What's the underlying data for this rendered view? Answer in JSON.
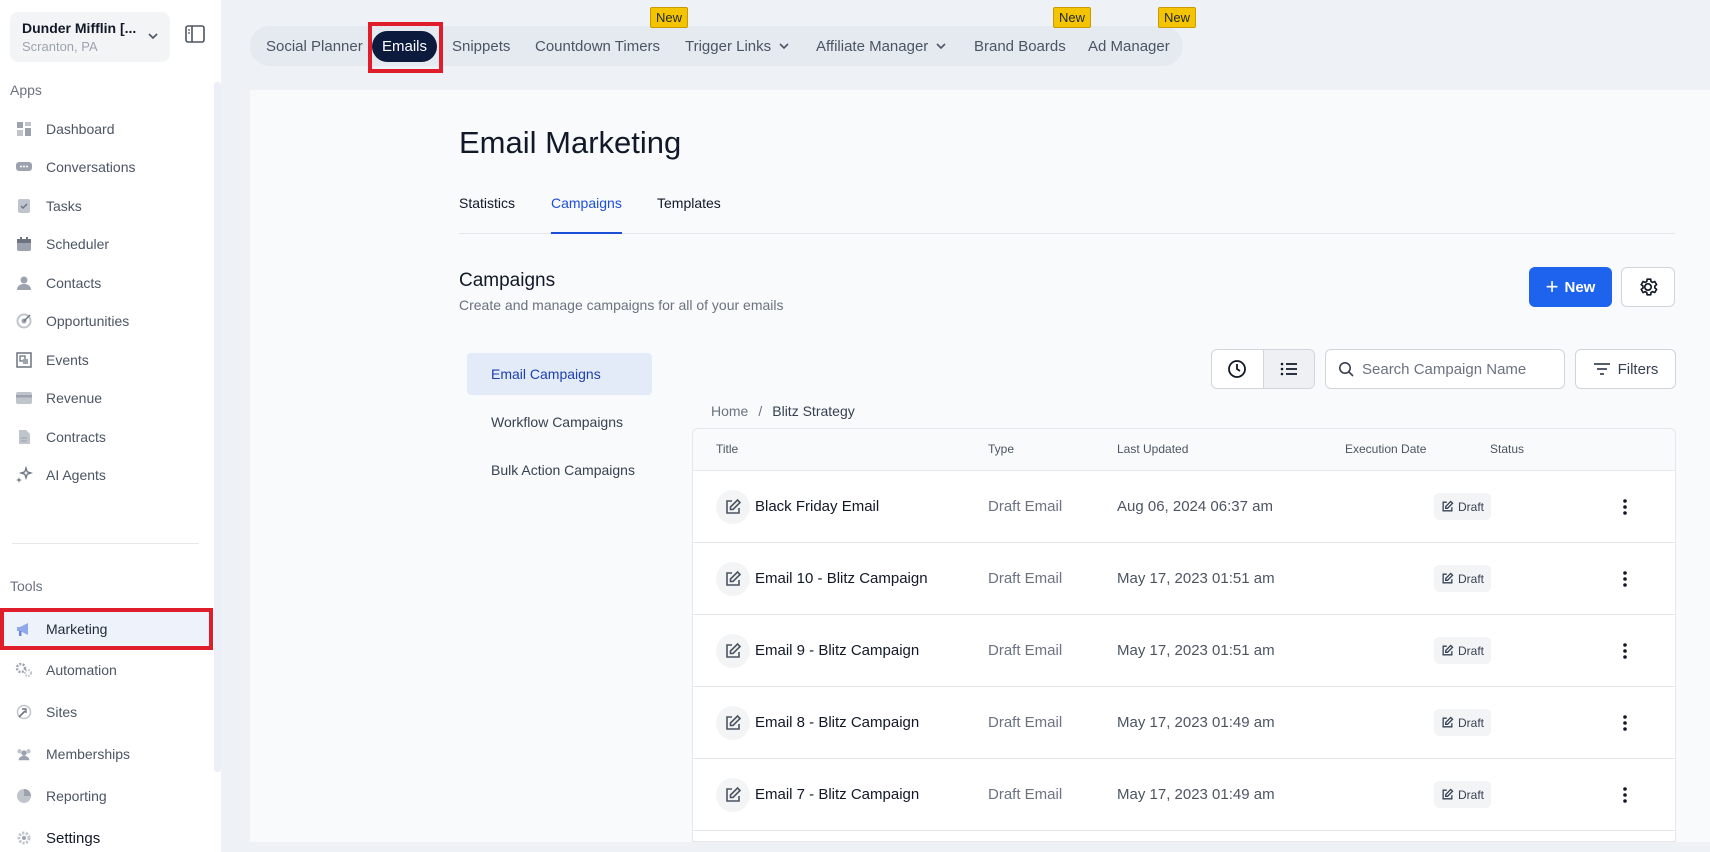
{
  "location": {
    "name": "Dunder Mifflin [...",
    "sub": "Scranton, PA"
  },
  "sidebar": {
    "apps_label": "Apps",
    "tools_label": "Tools",
    "apps": [
      {
        "label": "Dashboard",
        "icon": "dashboard-icon"
      },
      {
        "label": "Conversations",
        "icon": "chat-icon"
      },
      {
        "label": "Tasks",
        "icon": "tasks-icon"
      },
      {
        "label": "Scheduler",
        "icon": "calendar-icon"
      },
      {
        "label": "Contacts",
        "icon": "person-icon"
      },
      {
        "label": "Opportunities",
        "icon": "target-icon"
      },
      {
        "label": "Events",
        "icon": "events-icon"
      },
      {
        "label": "Revenue",
        "icon": "card-icon"
      },
      {
        "label": "Contracts",
        "icon": "document-icon"
      },
      {
        "label": "AI Agents",
        "icon": "sparkle-icon"
      }
    ],
    "tools": [
      {
        "label": "Marketing",
        "icon": "megaphone-icon"
      },
      {
        "label": "Automation",
        "icon": "gears-icon"
      },
      {
        "label": "Sites",
        "icon": "sites-icon"
      },
      {
        "label": "Memberships",
        "icon": "group-icon"
      },
      {
        "label": "Reporting",
        "icon": "pie-icon"
      },
      {
        "label": "Settings",
        "icon": "gear-icon"
      }
    ]
  },
  "topnav": {
    "items": [
      {
        "label": "Social Planner"
      },
      {
        "label": "Emails",
        "active": true
      },
      {
        "label": "Snippets"
      },
      {
        "label": "Countdown Timers",
        "badge": "New"
      },
      {
        "label": "Trigger Links",
        "dropdown": true
      },
      {
        "label": "Affiliate Manager",
        "dropdown": true
      },
      {
        "label": "Brand Boards",
        "badge": "New"
      },
      {
        "label": "Ad Manager",
        "badge": "New"
      }
    ]
  },
  "page": {
    "title": "Email Marketing",
    "tabs": [
      {
        "label": "Statistics"
      },
      {
        "label": "Campaigns",
        "active": true
      },
      {
        "label": "Templates"
      }
    ],
    "section_title": "Campaigns",
    "section_subtitle": "Create and manage campaigns for all of your emails",
    "new_button": "New",
    "side_tabs": [
      {
        "label": "Email Campaigns",
        "active": true
      },
      {
        "label": "Workflow Campaigns"
      },
      {
        "label": "Bulk Action Campaigns"
      }
    ],
    "search_placeholder": "Search Campaign Name",
    "filters_label": "Filters",
    "breadcrumb": {
      "home": "Home",
      "separator": "/",
      "current": "Blitz Strategy"
    }
  },
  "table": {
    "headers": {
      "title": "Title",
      "type": "Type",
      "last_updated": "Last Updated",
      "execution_date": "Execution Date",
      "status": "Status"
    },
    "rows": [
      {
        "title": "Black Friday Email",
        "type": "Draft Email",
        "last_updated": "Aug 06, 2024 06:37 am",
        "execution_date": "",
        "status": "Draft"
      },
      {
        "title": "Email 10 - Blitz Campaign",
        "type": "Draft Email",
        "last_updated": "May 17, 2023 01:51 am",
        "execution_date": "",
        "status": "Draft"
      },
      {
        "title": "Email 9 - Blitz Campaign",
        "type": "Draft Email",
        "last_updated": "May 17, 2023 01:51 am",
        "execution_date": "",
        "status": "Draft"
      },
      {
        "title": "Email 8 - Blitz Campaign",
        "type": "Draft Email",
        "last_updated": "May 17, 2023 01:49 am",
        "execution_date": "",
        "status": "Draft"
      },
      {
        "title": "Email 7 - Blitz Campaign",
        "type": "Draft Email",
        "last_updated": "May 17, 2023 01:49 am",
        "execution_date": "",
        "status": "Draft"
      }
    ]
  },
  "colors": {
    "accent": "#1d63ed",
    "active_pill": "#0c1a3d",
    "highlight": "#e01e2b",
    "badge": "#f5c400"
  }
}
